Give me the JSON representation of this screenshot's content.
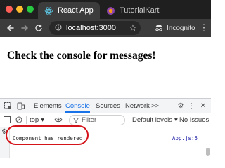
{
  "browser": {
    "window_controls": {
      "close_color": "#ff5f57",
      "minimize_color": "#febc2e",
      "maximize_color": "#28c840"
    },
    "tabs": [
      {
        "title": "React App",
        "active": true,
        "icon": "react-icon"
      },
      {
        "title": "TutorialKart",
        "active": false,
        "icon": "tutorialkart-icon"
      }
    ],
    "url": "localhost:3000",
    "profile_label": "Incognito"
  },
  "page": {
    "heading": "Check the console for messages!"
  },
  "devtools": {
    "tabs": [
      "Elements",
      "Console",
      "Sources",
      "Network"
    ],
    "active_tab": "Console",
    "more_tabs": ">>",
    "context": "top",
    "filter_placeholder": "Filter",
    "levels_label": "Default levels",
    "issues_label": "No Issues",
    "log": {
      "message": "Component has rendered.",
      "source": "App.js:5"
    },
    "accent_color": "#1a73e8",
    "highlight_color": "#d4141a"
  }
}
